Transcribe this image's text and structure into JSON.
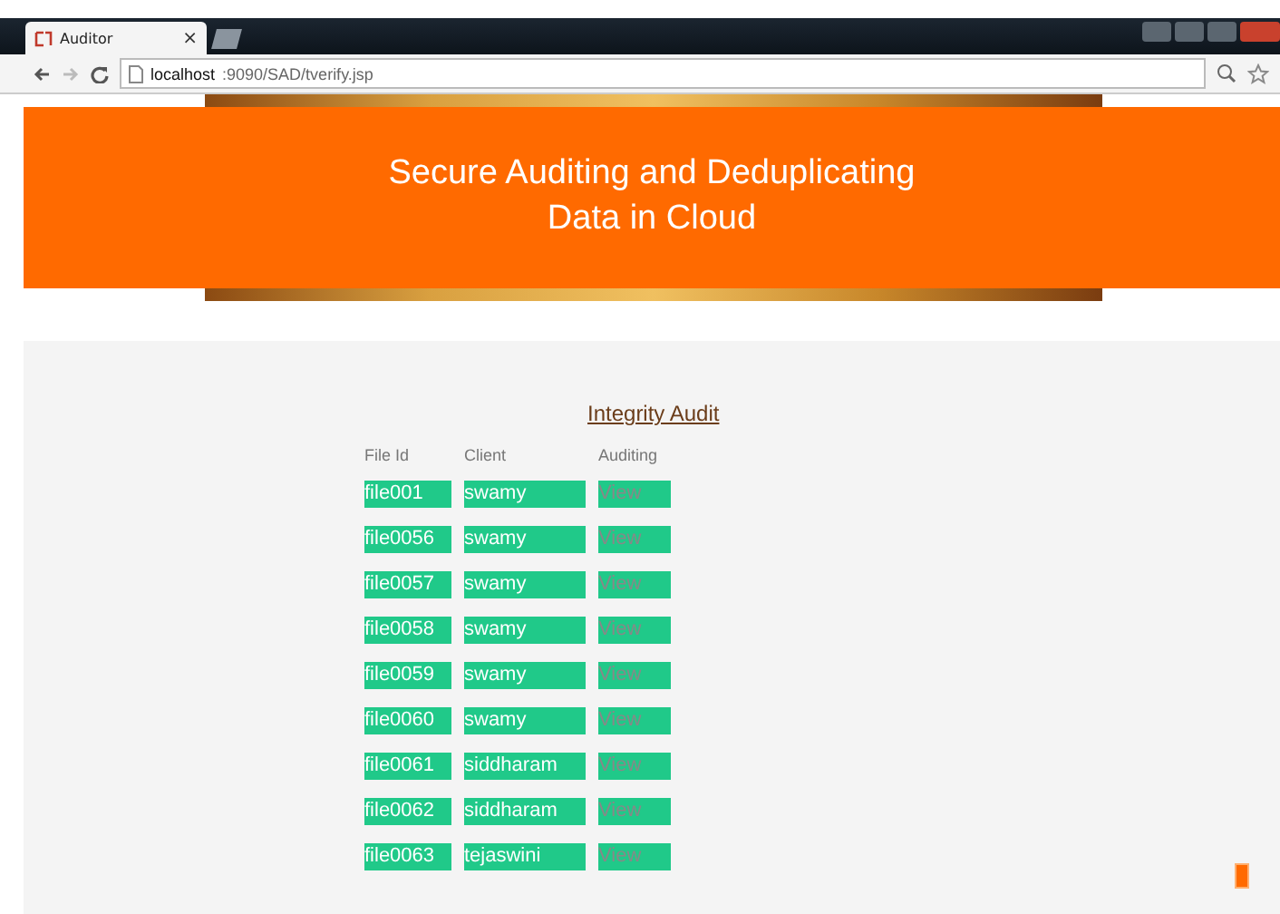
{
  "browser": {
    "tab_title": "Auditor",
    "tab_close": "×",
    "url_host": "localhost",
    "url_path": ":9090/SAD/tverify.jsp"
  },
  "header": {
    "title_line_1": "Secure Auditing and Deduplicating",
    "title_line_2": "Data in Cloud"
  },
  "section_title": "Integrity Audit",
  "table": {
    "columns": [
      "File Id",
      "Client",
      "Auditing"
    ],
    "rows": [
      {
        "file_id": "file001",
        "client": "swamy",
        "action": "View"
      },
      {
        "file_id": "file0056",
        "client": "swamy",
        "action": "View"
      },
      {
        "file_id": "file0057",
        "client": "swamy",
        "action": "View"
      },
      {
        "file_id": "file0058",
        "client": "swamy",
        "action": "View"
      },
      {
        "file_id": "file0059",
        "client": "swamy",
        "action": "View"
      },
      {
        "file_id": "file0060",
        "client": "swamy",
        "action": "View"
      },
      {
        "file_id": "file0061",
        "client": "siddharam",
        "action": "View"
      },
      {
        "file_id": "file0062",
        "client": "siddharam",
        "action": "View"
      },
      {
        "file_id": "file0063",
        "client": "tejaswini",
        "action": "View"
      }
    ]
  }
}
